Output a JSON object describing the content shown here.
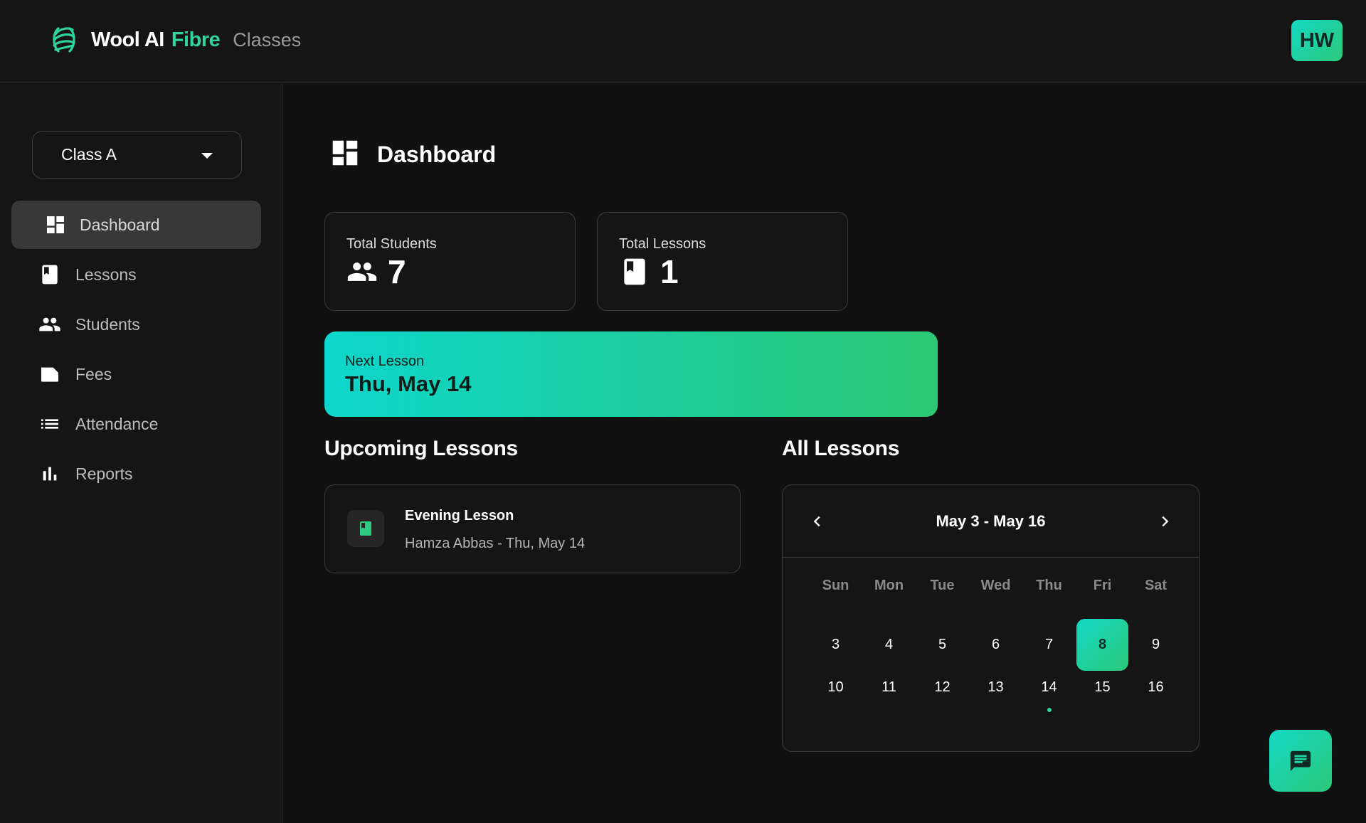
{
  "app": {
    "brand_name": "Wool AI",
    "brand_accent": "Fibre",
    "section": "Classes",
    "user_initials": "HW",
    "accent_color": "#2fd49a"
  },
  "sidebar": {
    "class_selector": "Class A",
    "items": [
      {
        "label": "Dashboard",
        "icon": "dashboard-icon",
        "active": true
      },
      {
        "label": "Lessons",
        "icon": "book-icon",
        "active": false
      },
      {
        "label": "Students",
        "icon": "people-icon",
        "active": false
      },
      {
        "label": "Fees",
        "icon": "label-icon",
        "active": false
      },
      {
        "label": "Attendance",
        "icon": "list-icon",
        "active": false
      },
      {
        "label": "Reports",
        "icon": "bar-chart-icon",
        "active": false
      }
    ]
  },
  "main": {
    "title": "Dashboard",
    "stats": [
      {
        "label": "Total Students",
        "value": "7",
        "icon": "people-icon"
      },
      {
        "label": "Total Lessons",
        "value": "1",
        "icon": "book-icon"
      }
    ],
    "next_lesson": {
      "label": "Next Lesson",
      "date": "Thu, May 14"
    },
    "upcoming": {
      "title": "Upcoming Lessons",
      "lessons": [
        {
          "title": "Evening Lesson",
          "subtitle": "Hamza Abbas - Thu, May 14"
        }
      ]
    },
    "all_lessons": {
      "title": "All Lessons",
      "range": "May 3 - May 16",
      "weekdays": [
        "Sun",
        "Mon",
        "Tue",
        "Wed",
        "Thu",
        "Fri",
        "Sat"
      ],
      "weeks": [
        [
          "3",
          "4",
          "5",
          "6",
          "7",
          "8",
          "9"
        ],
        [
          "10",
          "11",
          "12",
          "13",
          "14",
          "15",
          "16"
        ]
      ],
      "selected_day": "8",
      "days_with_lessons": [
        "14"
      ]
    }
  }
}
